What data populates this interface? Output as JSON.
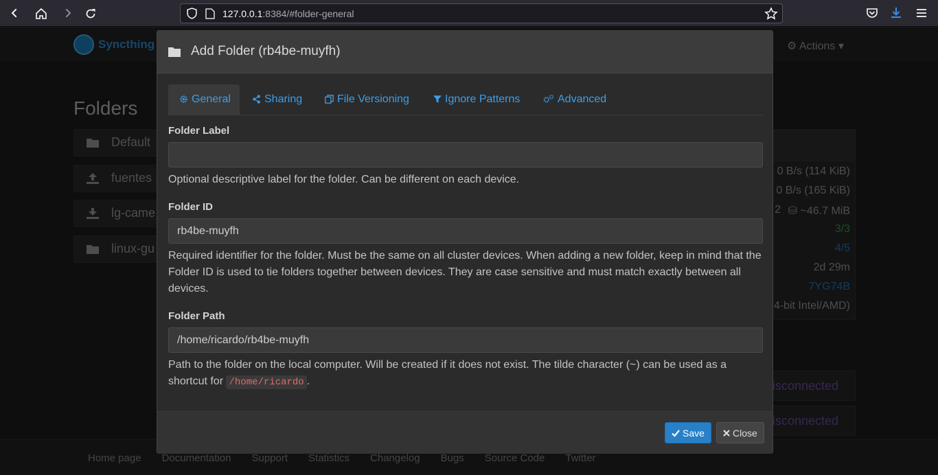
{
  "browser": {
    "url_host": "127.0.0.1",
    "url_rest": ":8384/#folder-general"
  },
  "app": {
    "brand": "Syncthing",
    "actions_label": "Actions",
    "folders_title": "Folders",
    "background_folders": [
      "Default",
      "fuentes",
      "lg-came",
      "linux-gu"
    ],
    "background_stats": [
      "0 B/s (114 KiB)",
      "0 B/s (165 KiB)",
      "2",
      "~46.7 MiB",
      "3/3",
      "4/5",
      "2d 29m",
      "7YG74B",
      "4-bit Intel/AMD)"
    ],
    "disconnected_label": "isconnected",
    "footer_links": [
      "Home page",
      "Documentation",
      "Support",
      "Statistics",
      "Changelog",
      "Bugs",
      "Source Code",
      "Twitter"
    ]
  },
  "modal": {
    "title": "Add Folder (rb4be-muyfh)",
    "tabs": [
      {
        "label": "General",
        "icon": "gear-icon"
      },
      {
        "label": "Sharing",
        "icon": "share-icon"
      },
      {
        "label": "File Versioning",
        "icon": "copy-icon"
      },
      {
        "label": "Ignore Patterns",
        "icon": "filter-icon"
      },
      {
        "label": "Advanced",
        "icon": "cogs-icon"
      }
    ],
    "folder_label": {
      "label": "Folder Label",
      "value": "",
      "help": "Optional descriptive label for the folder. Can be different on each device."
    },
    "folder_id": {
      "label": "Folder ID",
      "value": "rb4be-muyfh",
      "help": "Required identifier for the folder. Must be the same on all cluster devices. When adding a new folder, keep in mind that the Folder ID is used to tie folders together between devices. They are case sensitive and must match exactly between all devices."
    },
    "folder_path": {
      "label": "Folder Path",
      "value": "/home/ricardo/rb4be-muyfh",
      "help_before": "Path to the folder on the local computer. Will be created if it does not exist. The tilde character (~) can be used as a shortcut for",
      "help_code": "/home/ricardo",
      "help_after": "."
    },
    "save_label": "Save",
    "close_label": "Close"
  },
  "colors": {
    "accent": "#3d9ee8",
    "save_button": "#2780c8"
  }
}
